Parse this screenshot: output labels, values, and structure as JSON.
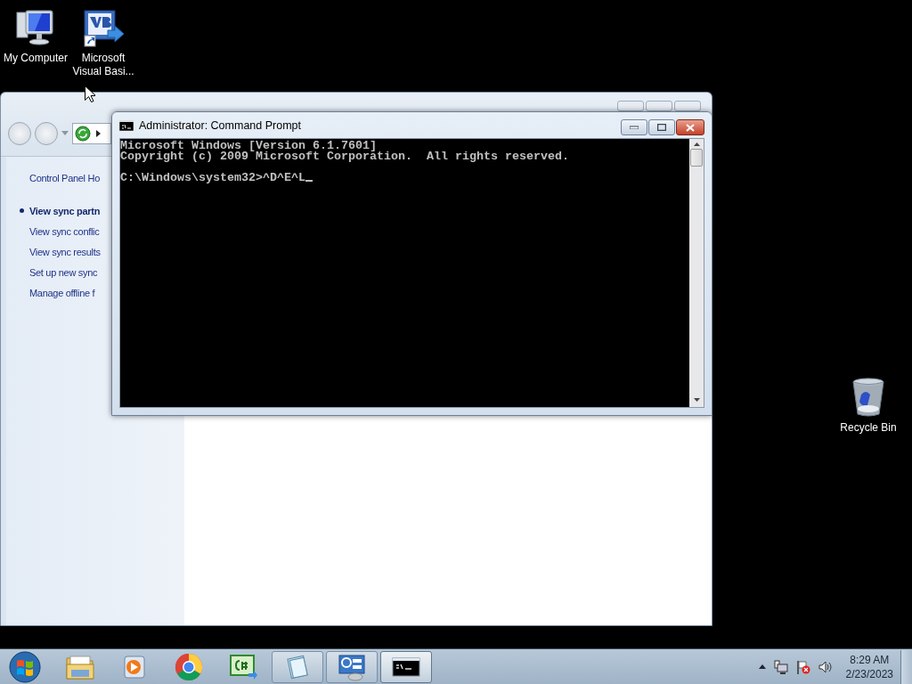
{
  "desktop_icons": [
    {
      "kind": "computer",
      "label": "My Computer"
    },
    {
      "kind": "vb-shortcut",
      "label": "Microsoft Visual Basi..."
    },
    {
      "kind": "recycle-bin",
      "label": "Recycle Bin"
    }
  ],
  "background_window": {
    "sidebar_items": [
      {
        "label": "Control Panel Ho",
        "selected": false
      },
      {
        "label": "View sync partn",
        "selected": true
      },
      {
        "label": "View sync conflic",
        "selected": false
      },
      {
        "label": "View sync results",
        "selected": false
      },
      {
        "label": "Set up new sync",
        "selected": false
      },
      {
        "label": "Manage offline f",
        "selected": false
      }
    ]
  },
  "console_window": {
    "title": "Administrator: Command Prompt",
    "lines": [
      {
        "text": "Microsoft Windows [Version 6.1.7601]",
        "space_before": false
      },
      {
        "text": "Copyright (c) 2009 Microsoft Corporation.  All rights reserved.",
        "space_before": false
      },
      {
        "text": "C:\\Windows\\system32>^D^E^L",
        "space_before": true
      }
    ],
    "cursor": true
  },
  "taskbar": {
    "items": [
      {
        "kind": "start",
        "running": false,
        "selected": false
      },
      {
        "kind": "folder",
        "running": false,
        "selected": false
      },
      {
        "kind": "media",
        "running": false,
        "selected": false
      },
      {
        "kind": "browser",
        "running": false,
        "selected": false
      },
      {
        "kind": "csharp",
        "running": false,
        "selected": false
      },
      {
        "kind": "notepad",
        "running": true,
        "selected": false
      },
      {
        "kind": "control-panel",
        "running": true,
        "selected": false
      },
      {
        "kind": "console",
        "running": true,
        "selected": true
      }
    ],
    "time": "8:29 AM",
    "date": "2/23/2023"
  }
}
